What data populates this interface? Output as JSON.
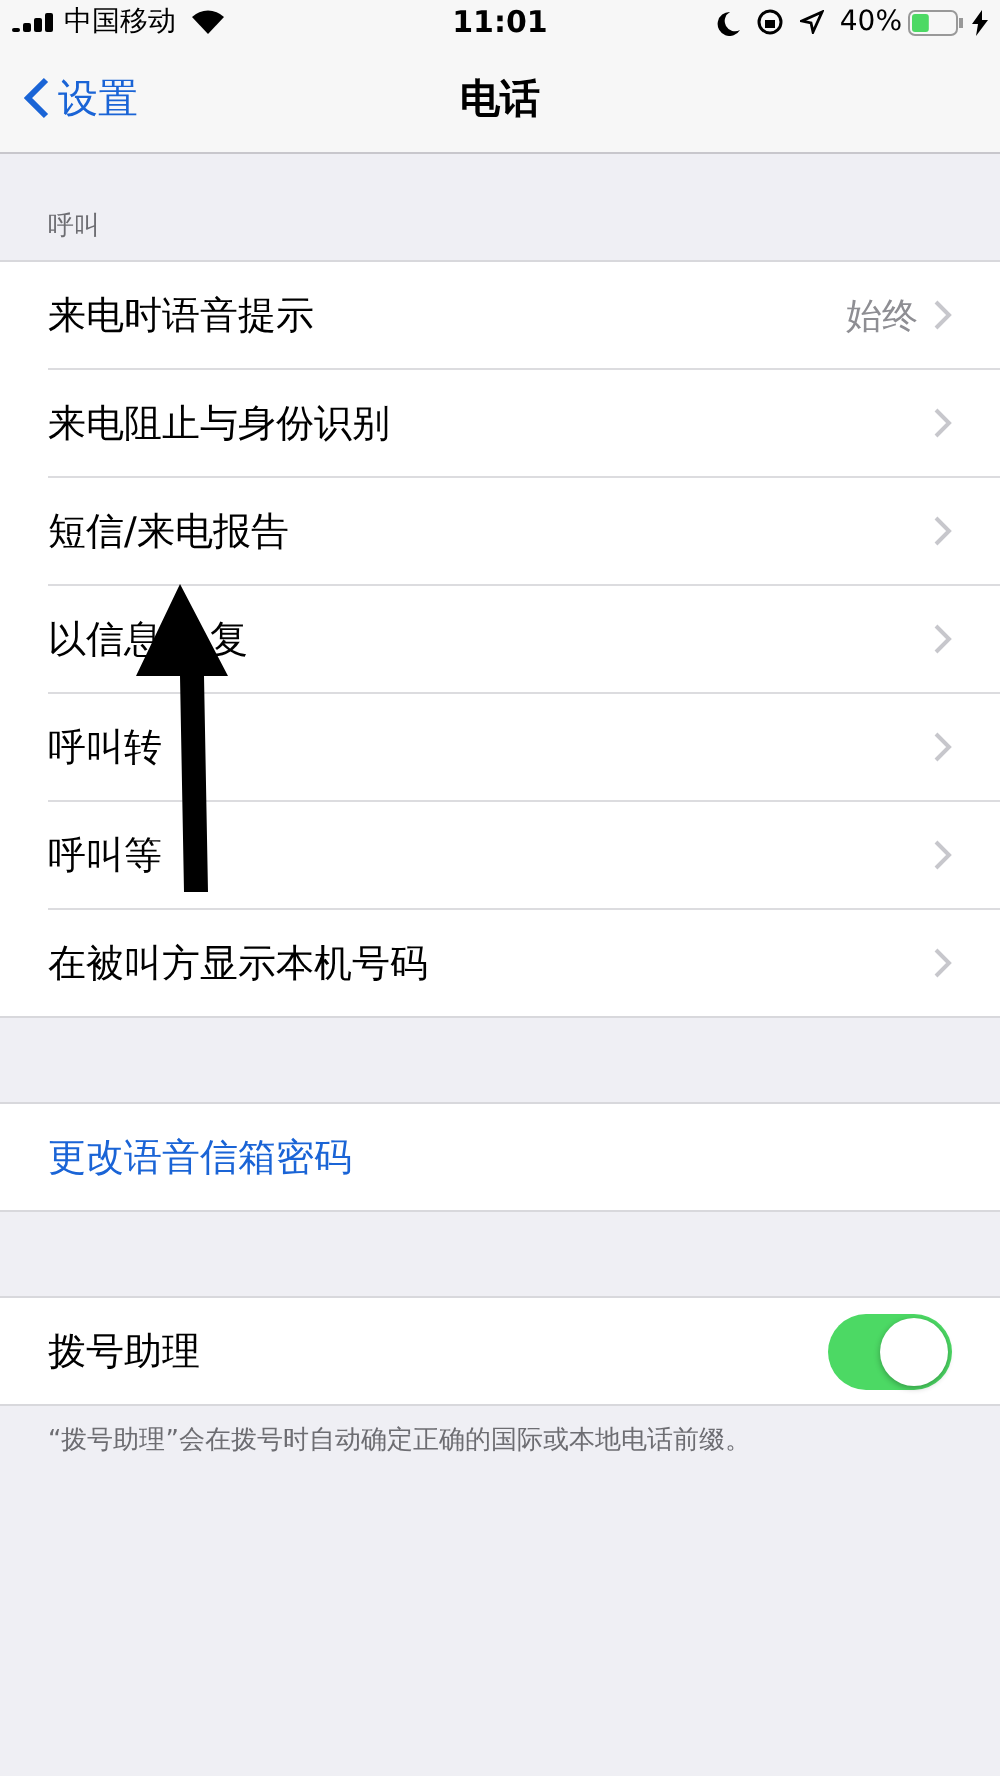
{
  "status_bar": {
    "carrier": "中国移动",
    "time": "11:01",
    "battery": "40%",
    "level": 0.4
  },
  "nav": {
    "back": "设置",
    "title": "电话"
  },
  "sections": [
    {
      "header": "呼叫",
      "rows": [
        {
          "kind": "disclosure",
          "label": "来电时语音提示",
          "value": "始终"
        },
        {
          "kind": "disclosure",
          "label": "来电阻止与身份识别"
        },
        {
          "kind": "disclosure",
          "label": "短信/来电报告"
        },
        {
          "kind": "disclosure",
          "label": "以信息",
          "label_after_arrow": "复"
        },
        {
          "kind": "disclosure",
          "label": "呼叫转"
        },
        {
          "kind": "disclosure",
          "label": "呼叫等"
        },
        {
          "kind": "disclosure",
          "label": "在被叫方显示本机号码"
        }
      ]
    },
    {
      "rows": [
        {
          "kind": "link",
          "label": "更改语音信箱密码"
        }
      ]
    },
    {
      "rows": [
        {
          "kind": "toggle",
          "label": "拨号助理",
          "on": true
        }
      ],
      "footer": "“拨号助理”会在拨号时自动确定正确的国际或本地电话前缀。"
    }
  ]
}
